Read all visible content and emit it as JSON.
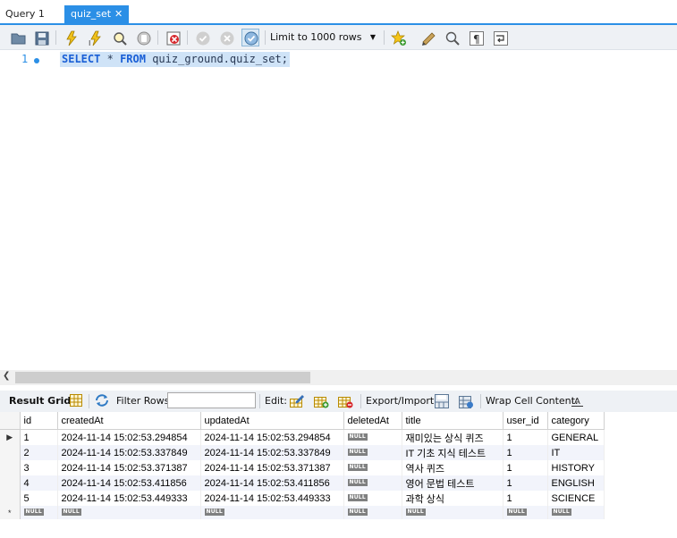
{
  "tabs": [
    {
      "label": "Query 1",
      "active": false
    },
    {
      "label": "quiz_set",
      "active": true
    }
  ],
  "toolbar": {
    "limit_select": "Limit to 1000 rows",
    "icons": [
      "open-folder-icon",
      "save-icon",
      "execute-icon",
      "execute-current-icon",
      "explain-icon",
      "stop-icon",
      "toggle-continue-icon",
      "commit-icon",
      "rollback-icon",
      "autocommit-icon",
      "limit-dropdown",
      "add-snippet-icon",
      "beautify-icon",
      "find-icon",
      "invisible-chars-icon",
      "wrap-icon"
    ]
  },
  "editor": {
    "line_number": "1",
    "query": {
      "select": "SELECT",
      "star": "*",
      "from": "FROM",
      "target": "quiz_ground.quiz_set;"
    }
  },
  "result_toolbar": {
    "result_grid": "Result Grid",
    "filter_rows": "Filter Rows:",
    "edit": "Edit:",
    "export_import": "Export/Import:",
    "wrap_cell": "Wrap Cell Content:"
  },
  "grid": {
    "columns": [
      "id",
      "createdAt",
      "updatedAt",
      "deletedAt",
      "title",
      "user_id",
      "category"
    ],
    "null_label": "NULL",
    "rows": [
      {
        "id": "1",
        "createdAt": "2024-11-14 15:02:53.294854",
        "updatedAt": "2024-11-14 15:02:53.294854",
        "deletedAt": "NULL",
        "title": "재미있는 상식 퀴즈",
        "user_id": "1",
        "category": "GENERAL"
      },
      {
        "id": "2",
        "createdAt": "2024-11-14 15:02:53.337849",
        "updatedAt": "2024-11-14 15:02:53.337849",
        "deletedAt": "NULL",
        "title": "IT 기초 지식 테스트",
        "user_id": "1",
        "category": "IT"
      },
      {
        "id": "3",
        "createdAt": "2024-11-14 15:02:53.371387",
        "updatedAt": "2024-11-14 15:02:53.371387",
        "deletedAt": "NULL",
        "title": "역사 퀴즈",
        "user_id": "1",
        "category": "HISTORY"
      },
      {
        "id": "4",
        "createdAt": "2024-11-14 15:02:53.411856",
        "updatedAt": "2024-11-14 15:02:53.411856",
        "deletedAt": "NULL",
        "title": "영어 문법 테스트",
        "user_id": "1",
        "category": "ENGLISH"
      },
      {
        "id": "5",
        "createdAt": "2024-11-14 15:02:53.449333",
        "updatedAt": "2024-11-14 15:02:53.449333",
        "deletedAt": "NULL",
        "title": "과학 상식",
        "user_id": "1",
        "category": "SCIENCE"
      }
    ],
    "new_row_marker": "*"
  }
}
